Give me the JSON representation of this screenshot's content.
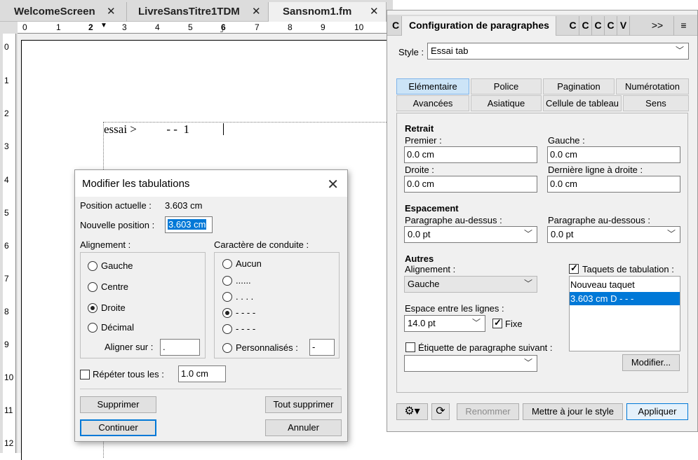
{
  "doc_tabs": [
    {
      "label": "WelcomeScreen",
      "close": "✕"
    },
    {
      "label": "LivreSansTitre1TDM",
      "close": "✕"
    },
    {
      "label": "Sansnom1.fm",
      "close": "✕"
    }
  ],
  "ruler": {
    "h": [
      "0",
      "1",
      "2",
      "3",
      "4",
      "5",
      "6",
      "7",
      "8",
      "9",
      "10"
    ],
    "v": [
      "0",
      "1",
      "2",
      "3",
      "4",
      "5",
      "6",
      "7",
      "8",
      "9",
      "10",
      "11",
      "12"
    ]
  },
  "document": {
    "text": "essai >          - -  1"
  },
  "dialog": {
    "title": "Modifier les tabulations",
    "current_position_label": "Position actuelle :",
    "current_position_value": "3.603 cm",
    "new_position_label": "Nouvelle position :",
    "new_position_value": "3.603 cm",
    "alignment_label": "Alignement :",
    "alignment_options": [
      "Gauche",
      "Centre",
      "Droite",
      "Décimal"
    ],
    "alignment_selected": "Droite",
    "align_on_label": "Aligner sur :",
    "align_on_value": ".",
    "leader_label": "Caractère de conduite :",
    "leader_options": [
      "Aucun",
      "......",
      ". . . .",
      "- - - -",
      "-  -  -  -",
      "Personnalisés :"
    ],
    "leader_selected": "- - - -",
    "custom_value": "-",
    "repeat_label": "Répéter tous les :",
    "repeat_value": "1.0 cm",
    "delete": "Supprimer",
    "delete_all": "Tout supprimer",
    "continue": "Continuer",
    "cancel": "Annuler"
  },
  "panel": {
    "tabs_short": [
      "C",
      "C",
      "C",
      "C",
      "C",
      "V"
    ],
    "active_tab": "Configuration de paragraphes",
    "more": ">>",
    "menu": "≡",
    "style_label": "Style :",
    "style_value": "Essai tab",
    "category_row1": [
      "Elémentaire",
      "Police",
      "Pagination",
      "Numérotation"
    ],
    "category_row2": [
      "Avancées",
      "Asiatique",
      "Cellule de tableau",
      "Sens"
    ],
    "active_category": "Elémentaire",
    "indent": {
      "heading": "Retrait",
      "first_label": "Premier :",
      "first_value": "0.0 cm",
      "left_label": "Gauche :",
      "left_value": "0.0 cm",
      "right_label": "Droite :",
      "right_value": "0.0 cm",
      "last_line_label": "Dernière ligne à droite :",
      "last_line_value": "0.0 cm"
    },
    "spacing": {
      "heading": "Espacement",
      "above_label": "Paragraphe au-dessus :",
      "above_value": "0.0 pt",
      "below_label": "Paragraphe au-dessous :",
      "below_value": "0.0 pt"
    },
    "other": {
      "heading": "Autres",
      "alignment_label": "Alignement :",
      "alignment_value": "Gauche",
      "line_spacing_label": "Espace entre les lignes :",
      "line_spacing_value": "14.0 pt",
      "fixed_label": "Fixe",
      "next_tag_label": "Étiquette de paragraphe suivant :",
      "next_tag_value": "",
      "tab_stops_label": "Taquets de tabulation :",
      "tab_stops": [
        "Nouveau taquet",
        "3.603 cm  D  - - -"
      ],
      "tab_stop_selected": 1,
      "modify": "Modifier..."
    },
    "footer": {
      "rename": "Renommer",
      "update_style": "Mettre à jour le style",
      "apply": "Appliquer"
    }
  }
}
